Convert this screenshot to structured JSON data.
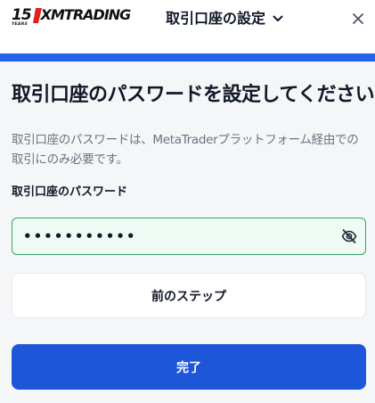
{
  "header": {
    "logo": {
      "anniversary": "15",
      "anniversary_caption": "YEARS",
      "brand": "XMTRADING"
    },
    "title": "取引口座の設定",
    "chevron_icon": "chevron-down-icon",
    "close_icon": "close-icon"
  },
  "accent_color": "#2563eb",
  "main": {
    "heading": "取引口座のパスワードを設定してください",
    "description_line1": "取引口座のパスワードは、MetaTraderプラットフォーム経由での",
    "description_line2": "取引にのみ必要です。",
    "password_label": "取引口座のパスワード",
    "password_value": "•••••••••••",
    "eye_icon": "eye-off-icon",
    "back_button": "前のステップ",
    "submit_button": "完了"
  }
}
